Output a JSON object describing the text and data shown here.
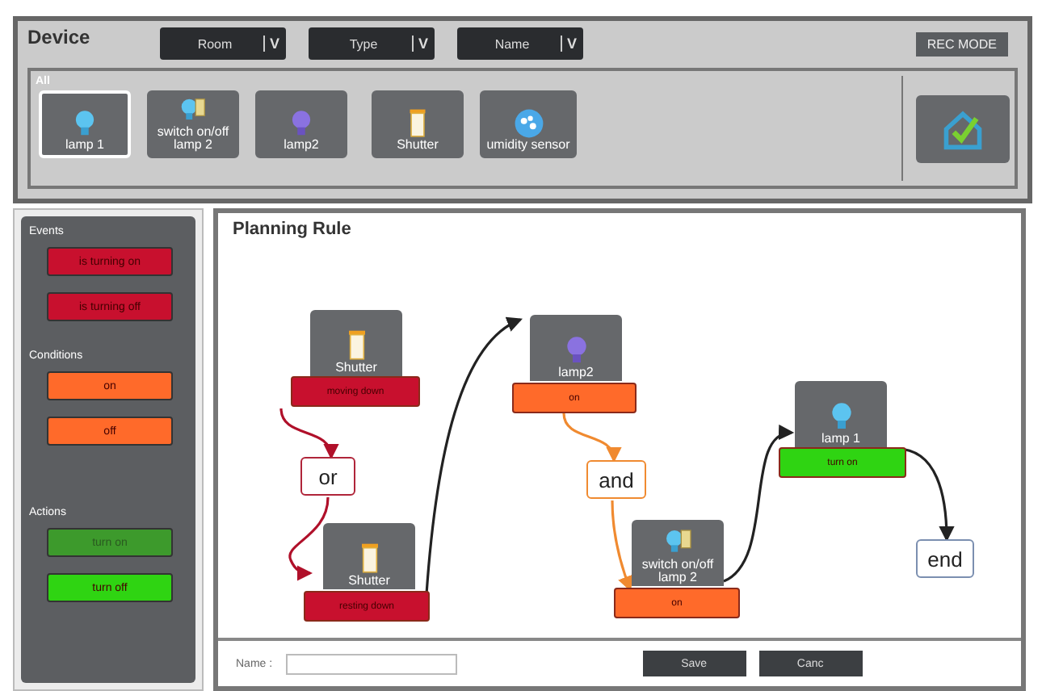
{
  "device_panel": {
    "title": "Device",
    "filters": [
      {
        "label": "Room",
        "caret": "V"
      },
      {
        "label": "Type",
        "caret": "V"
      },
      {
        "label": "Name",
        "caret": "V"
      }
    ],
    "rec_mode": "REC MODE",
    "group": "All",
    "devices": [
      {
        "label": "lamp 1",
        "selected": true
      },
      {
        "label": "switch on/off\nlamp 2",
        "selected": false
      },
      {
        "label": "lamp2",
        "selected": false
      },
      {
        "label": "Shutter",
        "selected": false
      },
      {
        "label": "umidity sensor",
        "selected": false
      }
    ]
  },
  "palette": {
    "sections": [
      {
        "title": "Events",
        "items": [
          {
            "label": "is turning on",
            "color": "#c8102e",
            "dim": false
          },
          {
            "label": "is turning off",
            "color": "#c8102e",
            "dim": false
          }
        ]
      },
      {
        "title": "Conditions",
        "items": [
          {
            "label": "on",
            "color": "#ff6a2a",
            "dim": false
          },
          {
            "label": "off",
            "color": "#ff6a2a",
            "dim": false
          }
        ]
      },
      {
        "title": "Actions",
        "items": [
          {
            "label": "turn on",
            "color": "#3d9a2c",
            "dim": true
          },
          {
            "label": "turn off",
            "color": "#2fd412",
            "dim": false
          }
        ]
      }
    ]
  },
  "rule": {
    "title": "Planning Rule",
    "nodes": [
      {
        "kind": "device",
        "label": "Shutter",
        "status": "moving down",
        "color": "#c8102e"
      },
      {
        "kind": "operator",
        "label": "or",
        "color": "#b0253a"
      },
      {
        "kind": "device",
        "label": "Shutter",
        "status": "resting down",
        "color": "#c8102e"
      },
      {
        "kind": "device",
        "label": "lamp2",
        "status": "on",
        "color": "#ff6a2a"
      },
      {
        "kind": "operator",
        "label": "and",
        "color": "#f08a30"
      },
      {
        "kind": "device",
        "label": "switch on/off\nlamp 2",
        "status": "on",
        "color": "#ff6a2a"
      },
      {
        "kind": "device",
        "label": "lamp 1",
        "status": "turn on",
        "color": "#2fd412"
      },
      {
        "kind": "operator",
        "label": "end",
        "color": "#7b8fb0"
      }
    ],
    "connections": [
      {
        "color": "#b0102a"
      },
      {
        "color": "#b0102a"
      },
      {
        "color": "#222222"
      },
      {
        "color": "#f08a30"
      },
      {
        "color": "#f08a30"
      },
      {
        "color": "#222222"
      },
      {
        "color": "#222222"
      }
    ]
  },
  "footer": {
    "name_label": "Name :",
    "buttons": [
      "Save",
      "Canc"
    ]
  }
}
